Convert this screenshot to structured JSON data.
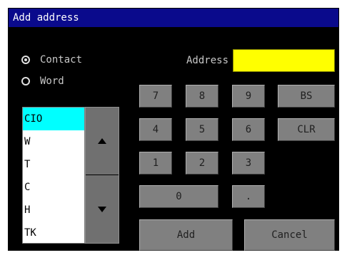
{
  "window": {
    "title": "Add address"
  },
  "mode": {
    "options": [
      {
        "label": "Contact",
        "checked": true
      },
      {
        "label": "Word",
        "checked": false
      }
    ]
  },
  "address": {
    "label": "Address",
    "value": "",
    "field_color": "#ffff00"
  },
  "area_list": {
    "items": [
      "CIO",
      "W",
      "T",
      "C",
      "H",
      "TK"
    ],
    "selected": "CIO",
    "selected_color": "#00ffff"
  },
  "scroll": {
    "up_icon": "triangle-up-icon",
    "down_icon": "triangle-down-icon"
  },
  "keypad": {
    "k7": "7",
    "k8": "8",
    "k9": "9",
    "bs": "BS",
    "k4": "4",
    "k5": "5",
    "k6": "6",
    "clr": "CLR",
    "k1": "1",
    "k2": "2",
    "k3": "3",
    "k0": "0",
    "dot": "."
  },
  "actions": {
    "add": "Add",
    "cancel": "Cancel"
  },
  "colors": {
    "title_bar": "#0a0a8c",
    "background": "#000000",
    "key": "#808080"
  }
}
